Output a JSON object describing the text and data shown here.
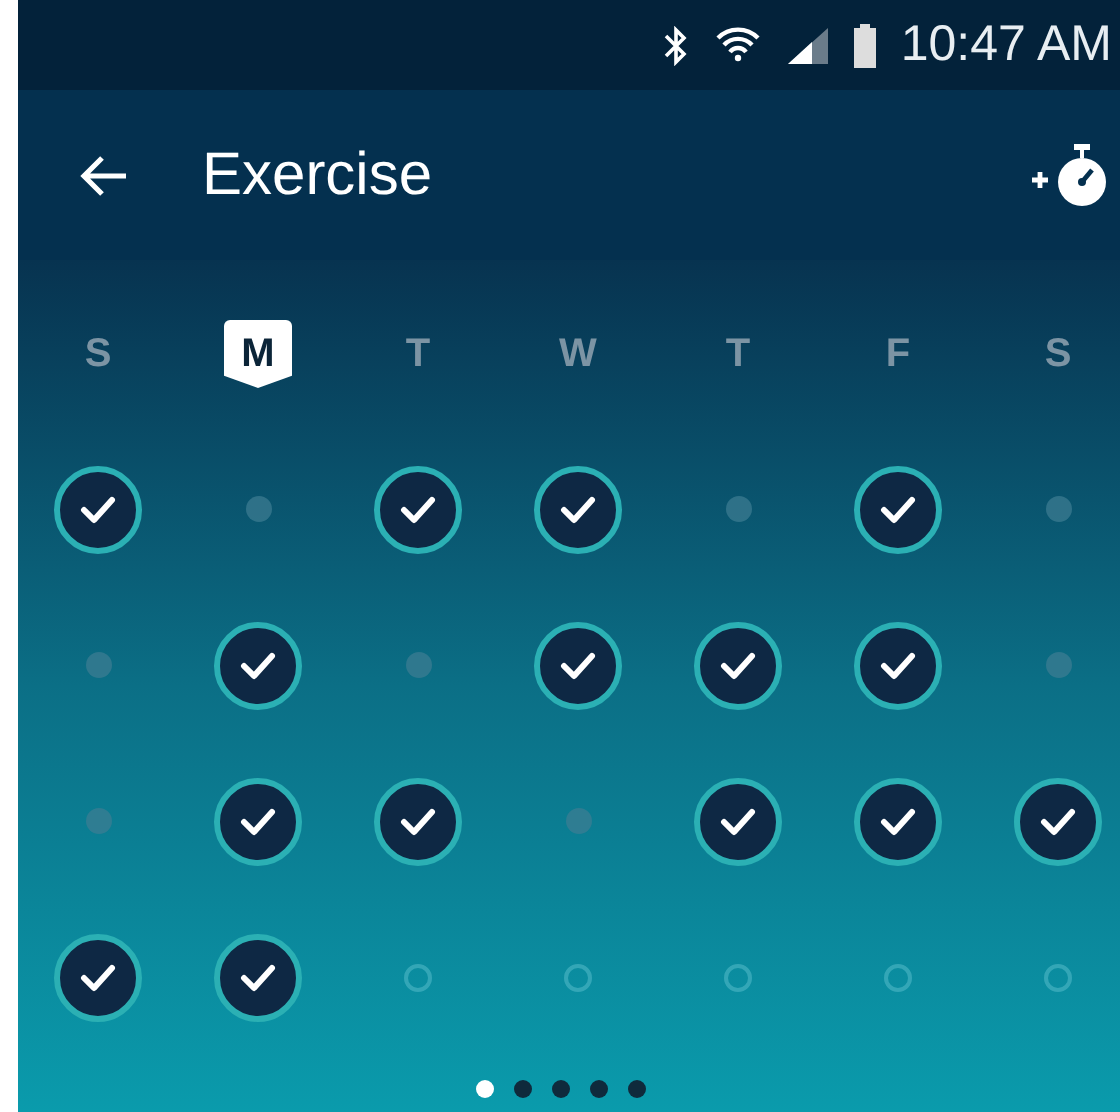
{
  "status_bar": {
    "time": "10:47 AM"
  },
  "app_bar": {
    "title": "Exercise"
  },
  "days": [
    {
      "label": "S",
      "selected": false
    },
    {
      "label": "M",
      "selected": true
    },
    {
      "label": "T",
      "selected": false
    },
    {
      "label": "W",
      "selected": false
    },
    {
      "label": "T",
      "selected": false
    },
    {
      "label": "F",
      "selected": false
    },
    {
      "label": "S",
      "selected": false
    }
  ],
  "weeks": [
    {
      "days": [
        {
          "kind": "check"
        },
        {
          "kind": "missed"
        },
        {
          "kind": "check"
        },
        {
          "kind": "check"
        },
        {
          "kind": "missed"
        },
        {
          "kind": "check"
        },
        {
          "kind": "missed"
        }
      ]
    },
    {
      "days": [
        {
          "kind": "missed"
        },
        {
          "kind": "check"
        },
        {
          "kind": "missed"
        },
        {
          "kind": "check"
        },
        {
          "kind": "check"
        },
        {
          "kind": "check"
        },
        {
          "kind": "missed"
        }
      ]
    },
    {
      "days": [
        {
          "kind": "missed"
        },
        {
          "kind": "check"
        },
        {
          "kind": "check"
        },
        {
          "kind": "missed"
        },
        {
          "kind": "check"
        },
        {
          "kind": "check"
        },
        {
          "kind": "check"
        }
      ]
    },
    {
      "days": [
        {
          "kind": "check"
        },
        {
          "kind": "check"
        },
        {
          "kind": "upcoming"
        },
        {
          "kind": "upcoming"
        },
        {
          "kind": "upcoming"
        },
        {
          "kind": "upcoming"
        },
        {
          "kind": "upcoming"
        }
      ]
    }
  ],
  "pages": [
    {
      "selected": true
    },
    {
      "selected": false
    },
    {
      "selected": false
    },
    {
      "selected": false
    },
    {
      "selected": false
    }
  ]
}
